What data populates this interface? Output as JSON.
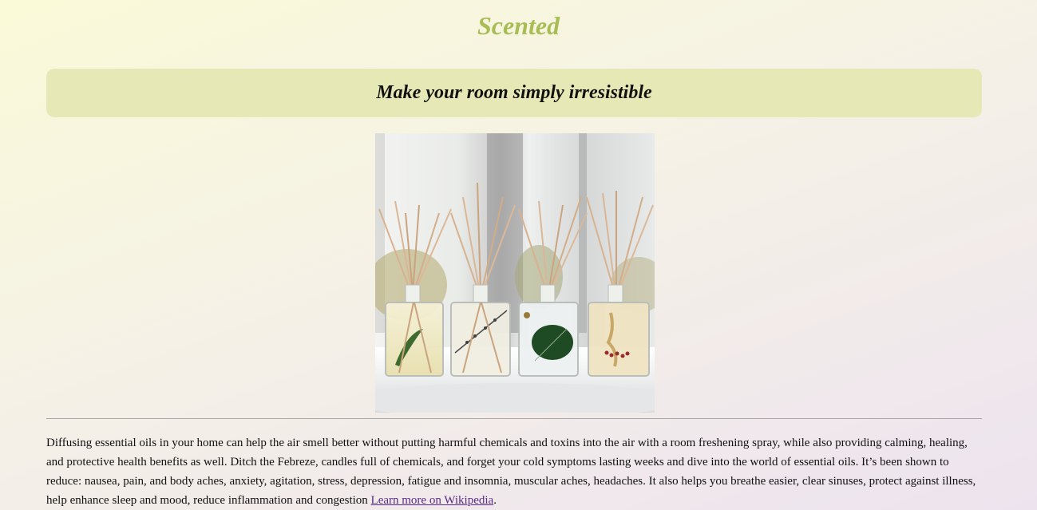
{
  "header": {
    "title": "Scented"
  },
  "banner": {
    "tagline": "Make your room simply irresistible"
  },
  "hero": {
    "icon": "reed-diffuser-photo"
  },
  "content": {
    "paragraph": "Diffusing essential oils in your home can help the air smell better without putting harmful chemicals and toxins into the air with a room freshening spray, while also providing calming, healing, and protective health benefits as well. Ditch the Febreze, candles full of chemicals, and forget your cold symptoms lasting weeks and dive into the world of essential oils. It’s been shown to reduce: nausea, pain, and body aches, anxiety, agitation, stress, depression, fatigue and insomnia, muscular aches, headaches. It also helps you breathe easier, clear sinuses, protect against illness, help enhance sleep and mood, reduce inflammation and congestion",
    "link_text": "Learn more on Wikipedia",
    "trailing": "."
  },
  "colors": {
    "title": "#a9bd55",
    "banner_bg": "#e6e9b5",
    "link": "#5b2a86"
  }
}
